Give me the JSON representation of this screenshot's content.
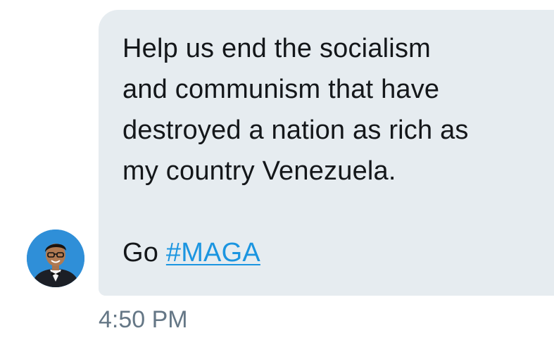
{
  "conversation": {
    "message": {
      "lines": [
        "Help us end the socialism",
        "and communism that have",
        "destroyed a nation as rich as",
        "my country Venezuela."
      ],
      "closing_prefix": "Go ",
      "hashtag": "#MAGA"
    },
    "timestamp": "4:50 PM",
    "avatar": {
      "icon": "user-avatar-icon"
    },
    "colors": {
      "bubble_background": "#e6ecf0",
      "text": "#14171a",
      "link": "#1b95e0",
      "timestamp": "#657786",
      "avatar_background": "#2f8fd8"
    }
  }
}
